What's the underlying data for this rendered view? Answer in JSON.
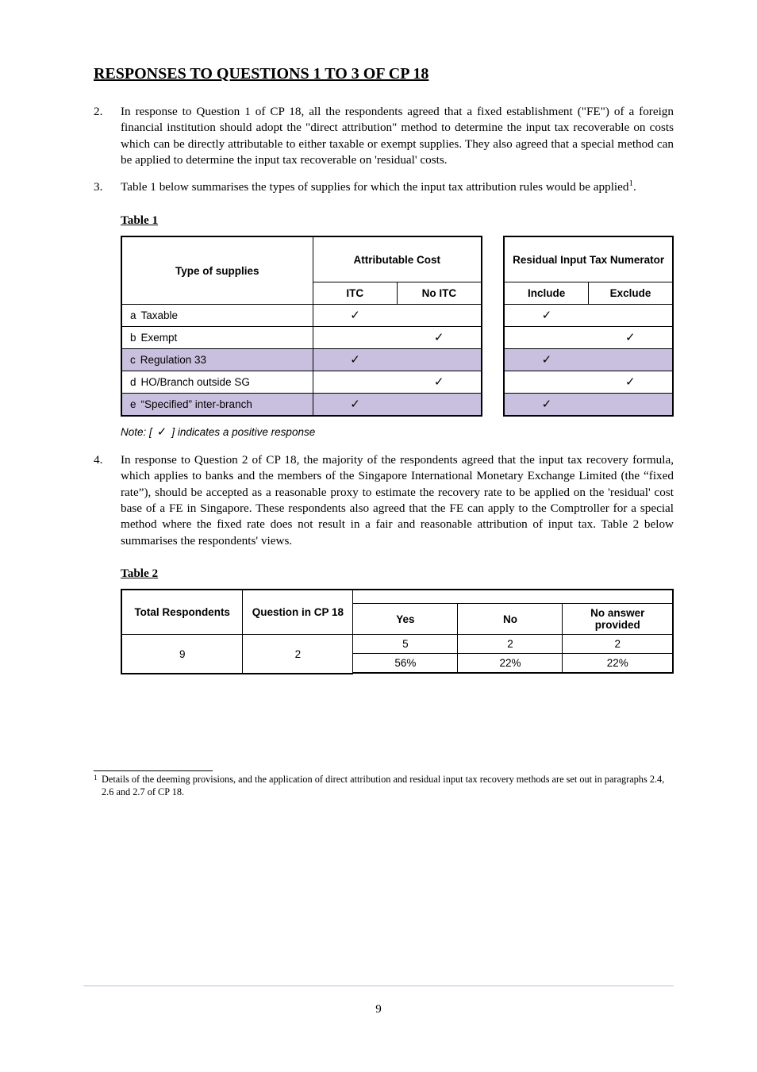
{
  "title": "RESPONSES TO QUESTIONS 1 TO 3 OF CP 18",
  "para1_num": "2.",
  "para1": "In response to Question 1 of CP 18, all the respondents agreed that a fixed establishment (\"FE\") of a foreign financial institution should adopt the \"direct attribution\" method to determine the input tax recoverable on costs which can be directly attributable to either taxable or exempt supplies. They also agreed that a special method can be applied to determine the input tax recoverable on 'residual' costs.",
  "para2_num": "3.",
  "para2_prefix": "Table 1 below summarises the types of supplies for which the input tax attribution rules would be applied",
  "para2_fn_marker": "1",
  "para2_suffix": ".",
  "table1_title": "Table 1",
  "t1": {
    "h_supply": "Type of supplies",
    "h_attr": "Attributable Cost",
    "h_res": "Residual Input Tax Numerator",
    "sub_itc": "ITC",
    "sub_noitc": "No ITC",
    "sub_incl": "Include",
    "sub_excl": "Exclude",
    "rows": [
      {
        "label": "Taxable",
        "attr_itc": "✓",
        "attr_noitc": "",
        "res_inc": "✓",
        "res_exc": "",
        "group": "a"
      },
      {
        "label": "Exempt",
        "attr_itc": "",
        "attr_noitc": "✓",
        "res_inc": "",
        "res_exc": "✓",
        "group": "b"
      },
      {
        "label": "Regulation 33",
        "attr_itc": "✓",
        "attr_noitc": "",
        "res_inc": "✓",
        "res_exc": "",
        "group": "c",
        "shade": true
      },
      {
        "label": "HO/Branch outside SG",
        "attr_itc": "",
        "attr_noitc": "✓",
        "res_inc": "",
        "res_exc": "✓",
        "group": "d"
      },
      {
        "label": "“Specified” inter-branch",
        "attr_itc": "✓",
        "attr_noitc": "",
        "res_inc": "✓",
        "res_exc": "",
        "group": "e",
        "shade": true
      }
    ],
    "row_markers": [
      "a",
      "b",
      "c",
      "d",
      "e"
    ]
  },
  "note_prefix": "Note: [",
  "note_tick": "✓",
  "note_suffix": "] indicates a positive response",
  "para3_num": "4.",
  "para3": "In response to Question 2 of CP 18, the majority of the respondents agreed that the input tax recovery formula, which applies to banks and the members of the Singapore International Monetary Exchange Limited (the “fixed rate”), should be accepted as a reasonable proxy to estimate the recovery rate to be applied on the 'residual' cost base of a FE in Singapore. These respondents also agreed that the FE can apply to the Comptroller for a special method where the fixed rate does not result in a fair and reasonable attribution of input tax. Table 2 below summarises the respondents' views.",
  "table2_title": "Table 2",
  "t2": {
    "h_total": "Total Respondents",
    "h_q": "Question in CP 18",
    "h_y": "Yes",
    "h_n": "No",
    "h_noans": "No answer provided",
    "total": "9",
    "q": "2",
    "y": "5",
    "n": "2",
    "noans": "2",
    "pct_y": "56%",
    "pct_n": "22%",
    "pct_noans": "22%"
  },
  "fn_marker": "1",
  "fn_text": "Details of the deeming provisions, and the application of direct attribution and residual input tax recovery methods are set out in paragraphs 2.4, 2.6 and 2.7 of CP 18.",
  "page_num": "9"
}
